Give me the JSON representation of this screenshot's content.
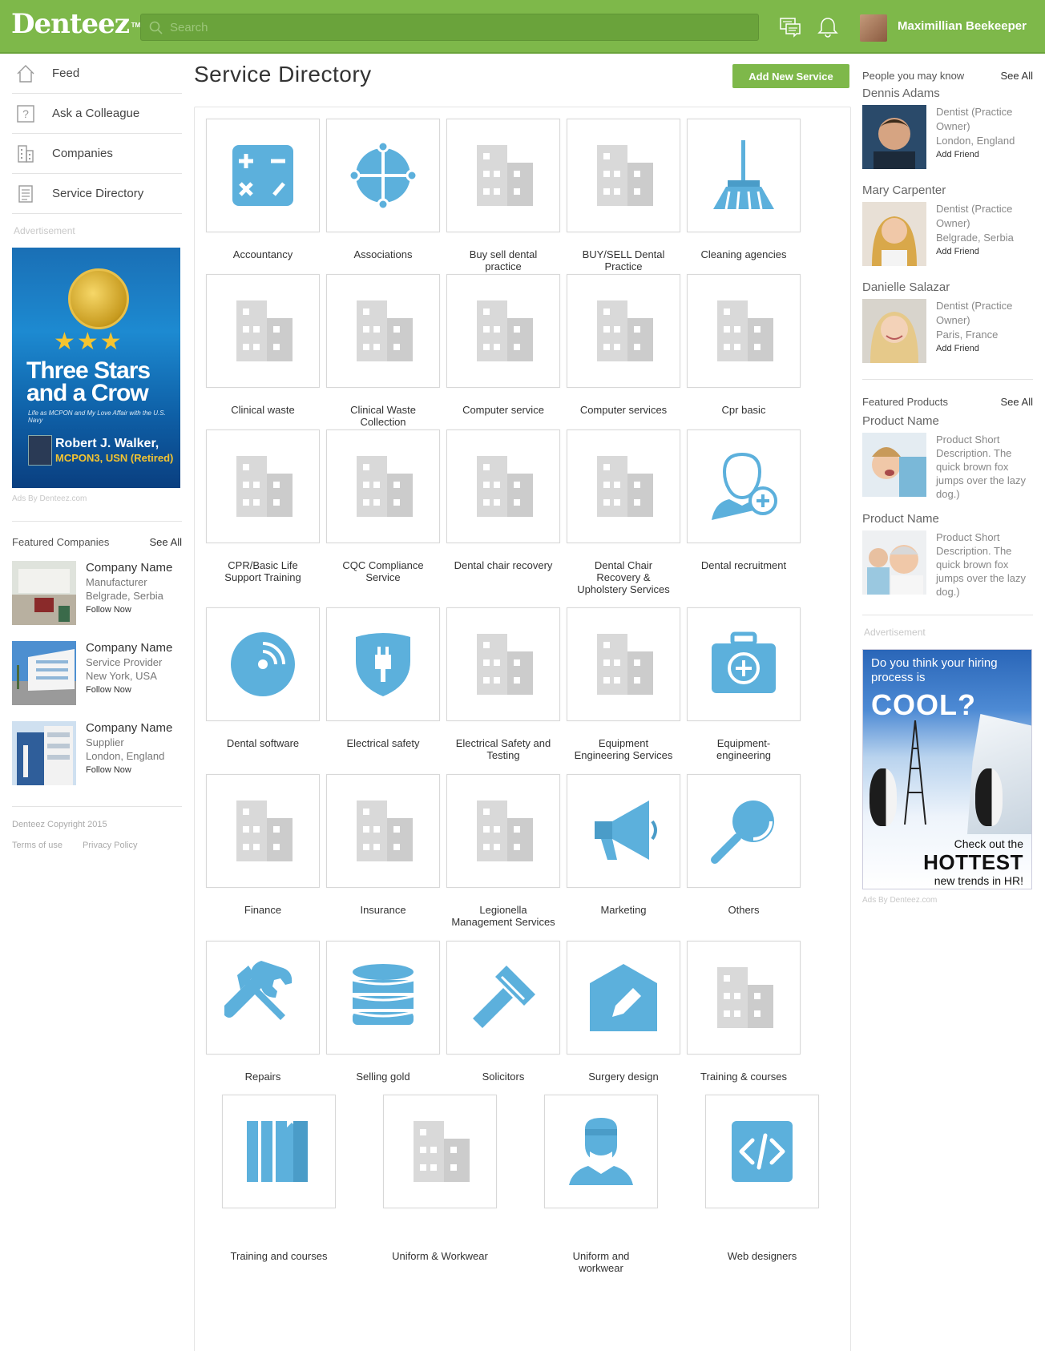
{
  "header": {
    "logo": "Denteez",
    "logo_tm": "TM",
    "search_placeholder": "Search",
    "user_name": "Maximillian Beekeeper"
  },
  "left_nav": [
    {
      "label": "Feed",
      "icon": "home-icon"
    },
    {
      "label": "Ask a Colleague",
      "icon": "question-icon"
    },
    {
      "label": "Companies",
      "icon": "building-icon"
    },
    {
      "label": "Service Directory",
      "icon": "list-icon"
    }
  ],
  "left_ad": {
    "label": "Advertisement",
    "title": "Three Stars and a Crow",
    "subtitle": "Life as MCPON and My Love Affair with the U.S. Navy",
    "author": "Robert J. Walker,",
    "author_rank": "MCPON3, USN (Retired)",
    "ads_by": "Ads By Denteez.com"
  },
  "featured_companies": {
    "title": "Featured Companies",
    "see_all": "See All",
    "items": [
      {
        "name": "Company Name",
        "type": "Manufacturer",
        "location": "Belgrade, Serbia",
        "action": "Follow Now"
      },
      {
        "name": "Company Name",
        "type": "Service Provider",
        "location": "New York, USA",
        "action": "Follow Now"
      },
      {
        "name": "Company Name",
        "type": "Supplier",
        "location": "London, England",
        "action": "Follow Now"
      }
    ]
  },
  "footer": {
    "copyright": "Denteez Copyright 2015",
    "terms": "Terms of use",
    "privacy": "Privacy Policy"
  },
  "main": {
    "title": "Service Directory",
    "add_button": "Add New Service"
  },
  "services": [
    {
      "label": "Accountancy",
      "icon": "calculator-icon"
    },
    {
      "label": "Associations",
      "icon": "crosshair-icon"
    },
    {
      "label": "Buy sell dental practice",
      "icon": "building-icon"
    },
    {
      "label": "BUY/SELL Dental Practice",
      "icon": "building-icon"
    },
    {
      "label": "Cleaning agencies",
      "icon": "broom-icon"
    },
    {
      "label": "Clinical waste",
      "icon": "building-icon"
    },
    {
      "label": "Clinical Waste Collection",
      "icon": "building-icon"
    },
    {
      "label": "Computer service",
      "icon": "building-icon"
    },
    {
      "label": "Computer services",
      "icon": "building-icon"
    },
    {
      "label": "Cpr basic",
      "icon": "building-icon"
    },
    {
      "label": "CPR/Basic Life Support Training",
      "icon": "building-icon"
    },
    {
      "label": "CQC Compliance Service",
      "icon": "building-icon"
    },
    {
      "label": "Dental chair recovery",
      "icon": "building-icon"
    },
    {
      "label": "Dental Chair Recovery & Upholstery Services",
      "icon": "building-icon"
    },
    {
      "label": "Dental recruitment",
      "icon": "person-add-icon"
    },
    {
      "label": "Dental software",
      "icon": "disc-icon"
    },
    {
      "label": "Electrical safety",
      "icon": "plug-shield-icon"
    },
    {
      "label": "Electrical Safety and Testing",
      "icon": "building-icon"
    },
    {
      "label": "Equipment Engineering Services",
      "icon": "building-icon"
    },
    {
      "label": "Equipment-engineering",
      "icon": "medkit-icon"
    },
    {
      "label": "Finance",
      "icon": "building-icon"
    },
    {
      "label": "Insurance",
      "icon": "building-icon"
    },
    {
      "label": "Legionella Management Services",
      "icon": "building-icon"
    },
    {
      "label": "Marketing",
      "icon": "megaphone-icon"
    },
    {
      "label": "Others",
      "icon": "magnifier-icon"
    },
    {
      "label": "Repairs",
      "icon": "tools-icon"
    },
    {
      "label": "Selling gold",
      "icon": "database-icon"
    },
    {
      "label": "Solicitors",
      "icon": "gavel-icon"
    },
    {
      "label": "Surgery design",
      "icon": "house-edit-icon"
    },
    {
      "label": "Training & courses",
      "icon": "building-icon"
    },
    {
      "label": "Training and courses",
      "icon": "books-icon"
    },
    {
      "label": "Uniform & Workwear",
      "icon": "building-icon"
    },
    {
      "label": "Uniform and workwear",
      "icon": "surgeon-icon"
    },
    {
      "label": "Web designers",
      "icon": "code-icon"
    }
  ],
  "people": {
    "title": "People you may know",
    "see_all": "See All",
    "items": [
      {
        "name": "Dennis Adams",
        "role": "Dentist (Practice Owner)",
        "location": "London, England",
        "action": "Add Friend"
      },
      {
        "name": "Mary Carpenter",
        "role": "Dentist (Practice Owner)",
        "location": "Belgrade, Serbia",
        "action": "Add Friend"
      },
      {
        "name": "Danielle Salazar",
        "role": "Dentist (Practice Owner)",
        "location": "Paris, France",
        "action": "Add Friend"
      }
    ]
  },
  "products": {
    "title": "Featured Products",
    "see_all": "See All",
    "items": [
      {
        "name": "Product Name",
        "description": "Product Short Description. The quick brown fox jumps over the lazy dog.)"
      },
      {
        "name": "Product Name",
        "description": "Product Short Description. The quick brown fox jumps over the lazy dog.)"
      }
    ]
  },
  "right_ad": {
    "label": "Advertisement",
    "question": "Do you think your hiring process is",
    "cool": "COOL?",
    "line1": "Check out the",
    "line2": "HOTTEST",
    "line3": "new trends in HR!",
    "ads_by": "Ads By Denteez.com"
  },
  "colors": {
    "brand_green": "#7eb84a",
    "icon_blue": "#5cb0dc",
    "placeholder_gray": "#d9d9d9"
  }
}
